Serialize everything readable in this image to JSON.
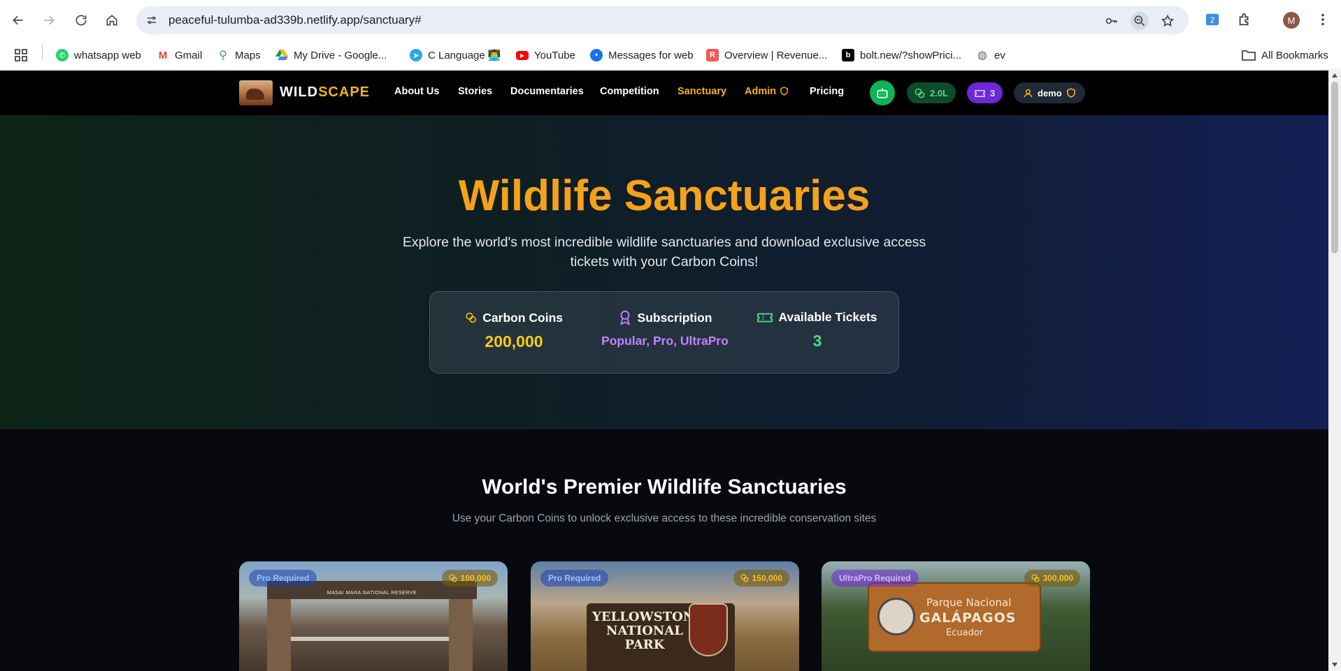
{
  "browser": {
    "url": "peaceful-tulumba-ad339b.netlify.app/sanctuary#",
    "profile_initial": "M",
    "bookmarks": [
      {
        "label": "whatsapp web",
        "icon": "whatsapp-icon",
        "color": "#25d366"
      },
      {
        "label": "Gmail",
        "icon": "gmail-icon",
        "color": "#ea4335"
      },
      {
        "label": "Maps",
        "icon": "maps-icon",
        "color": "#34a853"
      },
      {
        "label": "My Drive - Google...",
        "icon": "drive-icon",
        "color": "#fbbc04"
      },
      {
        "label": "C Language 👨‍💻",
        "icon": "telegram-icon",
        "color": "#29a9ea"
      },
      {
        "label": "YouTube",
        "icon": "youtube-icon",
        "color": "#ff0000"
      },
      {
        "label": "Messages for web",
        "icon": "messages-icon",
        "color": "#1a73e8"
      },
      {
        "label": "Overview | Revenue...",
        "icon": "revenuecat-icon",
        "color": "#f25a5a"
      },
      {
        "label": "bolt.new/?showPrici...",
        "icon": "bolt-icon",
        "color": "#000000"
      },
      {
        "label": "ev",
        "icon": "globe-icon",
        "color": "#5f6368"
      }
    ],
    "all_bookmarks": "All Bookmarks"
  },
  "site": {
    "logo_main": "WILD",
    "logo_accent": "SCAPE",
    "nav": [
      {
        "label": "About Us"
      },
      {
        "label": "Stories"
      },
      {
        "label": "Documentaries"
      },
      {
        "label": "Competition"
      },
      {
        "label": "Sanctuary"
      },
      {
        "label": "Admin"
      },
      {
        "label": "Pricing"
      }
    ],
    "coins_pill": "2.0L",
    "tickets_pill": "3",
    "user": "demo"
  },
  "hero": {
    "title": "Wildlife Sanctuaries",
    "subtitle": "Explore the world's most incredible wildlife sanctuaries and download exclusive access tickets with your Carbon Coins!",
    "stats": [
      {
        "label": "Carbon Coins",
        "value": "200,000",
        "color": "#facc15"
      },
      {
        "label": "Subscription",
        "value": "Popular, Pro, UltraPro",
        "color": "#c084fc"
      },
      {
        "label": "Available Tickets",
        "value": "3",
        "color": "#4ade80"
      }
    ]
  },
  "section": {
    "title": "World's Premier Wildlife Sanctuaries",
    "subtitle": "Use your Carbon Coins to unlock exclusive access to these incredible conservation sites"
  },
  "cards": [
    {
      "badge": "Pro Required",
      "price": "100,000",
      "image_text": "MASAI MARA NATIONAL RESERVE"
    },
    {
      "badge": "Pro Required",
      "price": "150,000",
      "image_text": "YELLOWSTONE NATIONAL PARK"
    },
    {
      "badge": "UltraPro Required",
      "price": "300,000",
      "image_text_1": "Parque Nacional",
      "image_text_2": "GALÁPAGOS",
      "image_text_3": "Ecuador"
    }
  ],
  "colors": {
    "accent": "#f5a21a",
    "bot_green": "#10b35a",
    "ticket_purple": "#6d28d9"
  }
}
